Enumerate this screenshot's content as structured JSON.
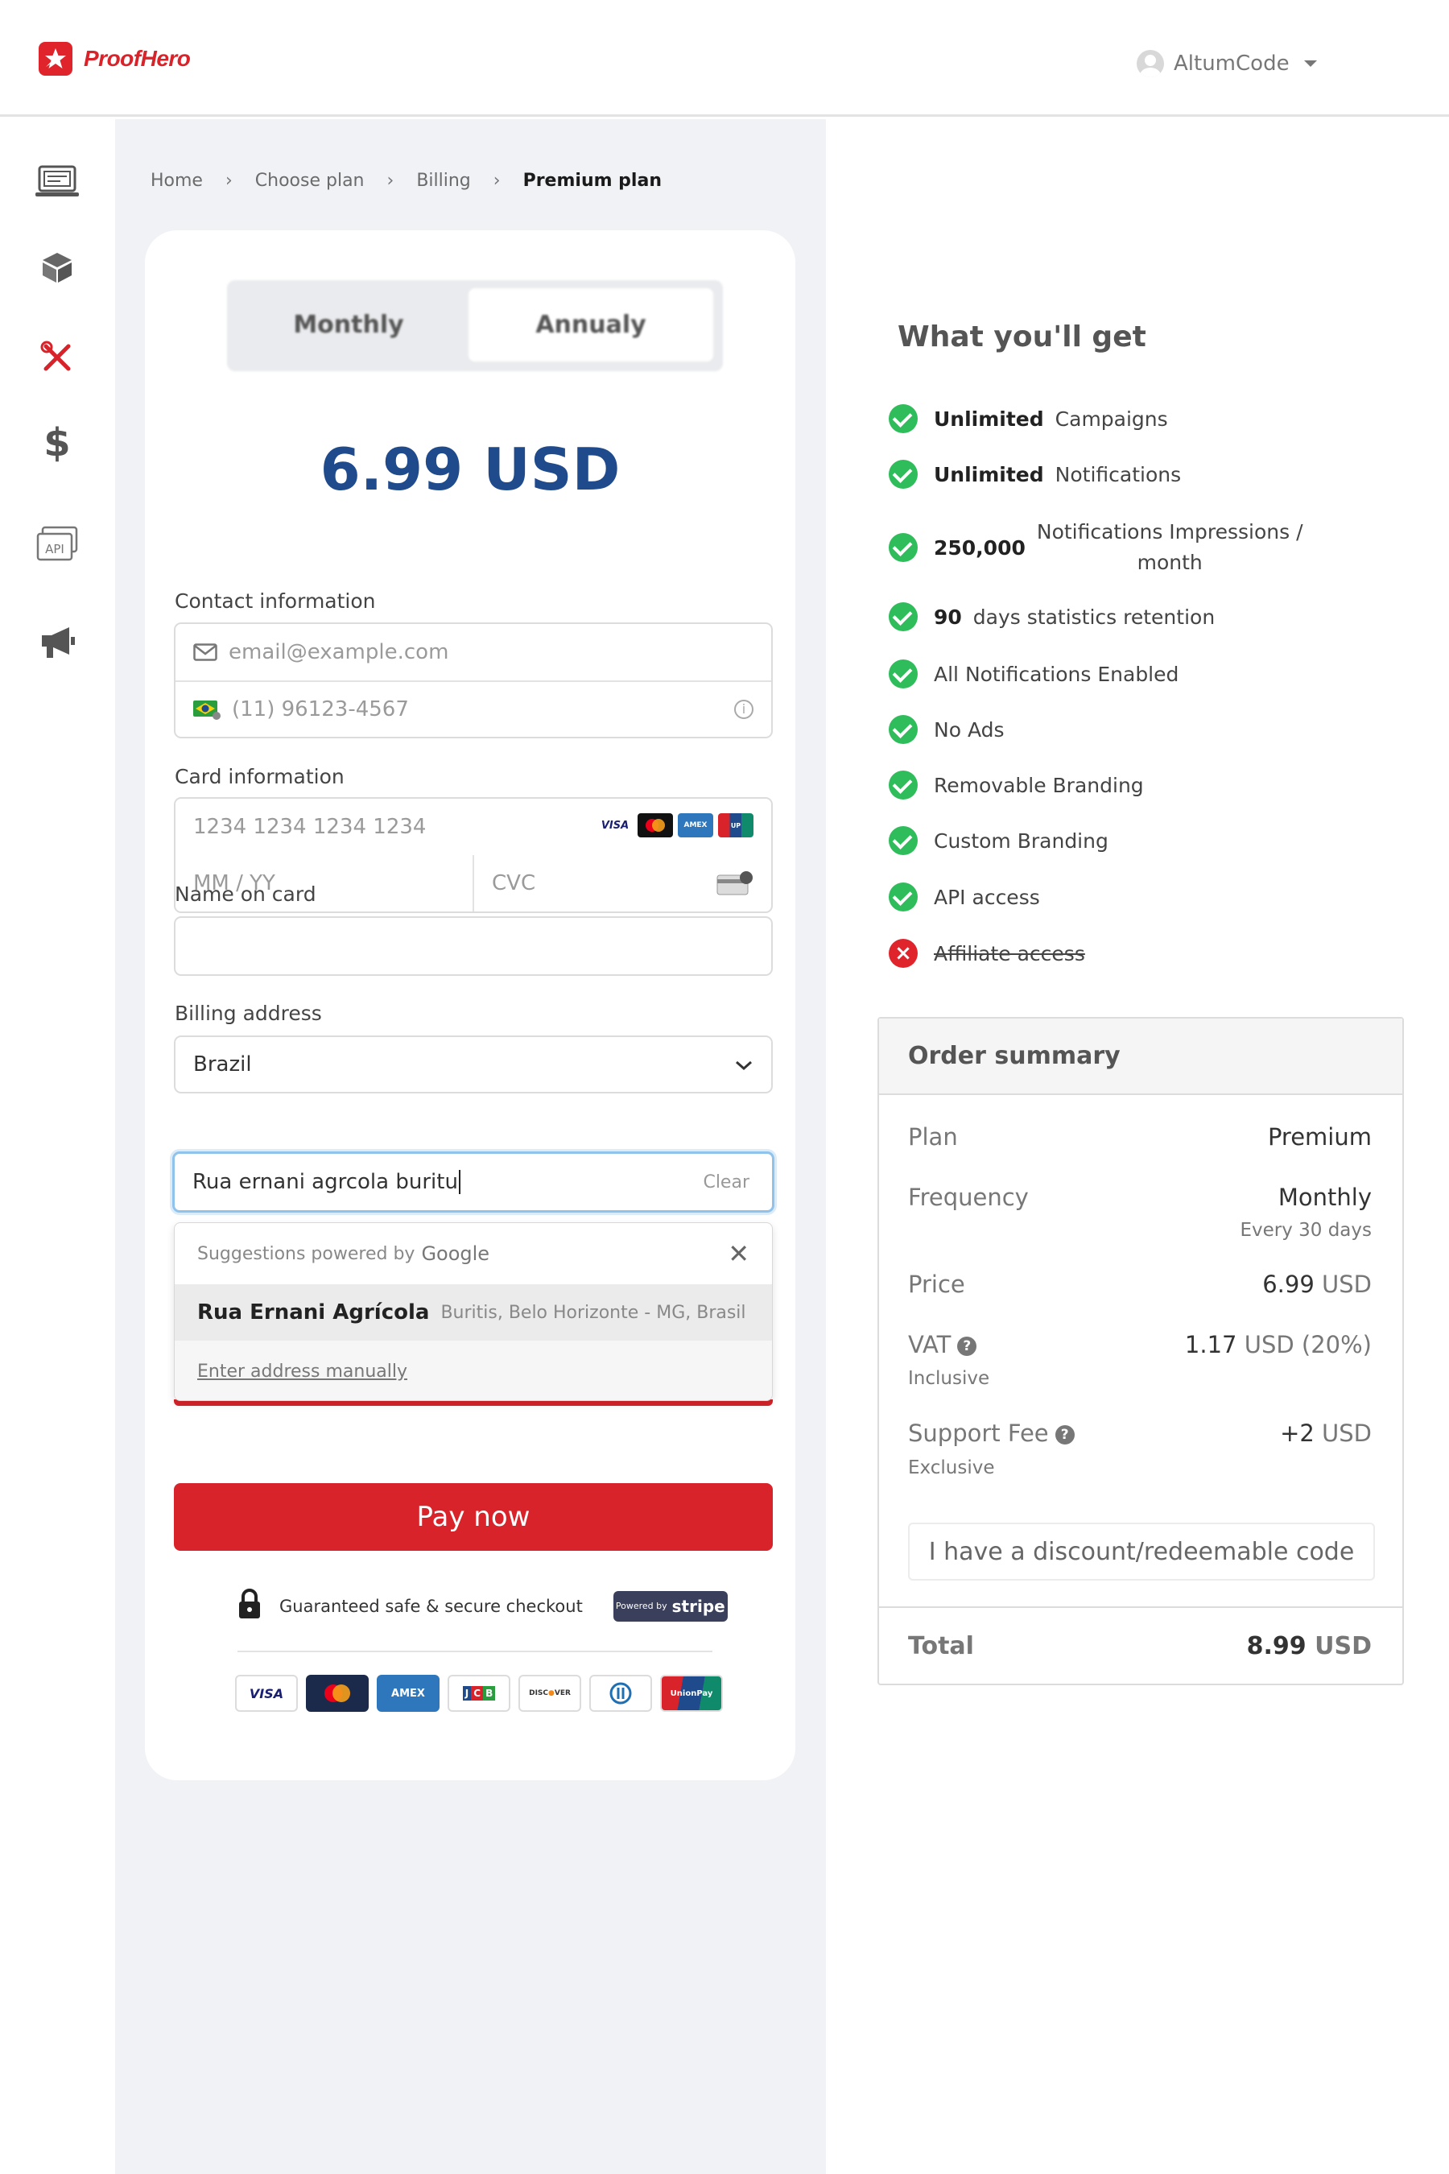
{
  "header": {
    "brand": "ProofHero",
    "user_name": "AltumCode"
  },
  "sidebar": {
    "items": [
      {
        "icon": "dashboard-icon"
      },
      {
        "icon": "package-icon"
      },
      {
        "icon": "tools-icon",
        "active": true
      },
      {
        "icon": "dollar-icon"
      },
      {
        "icon": "api-icon",
        "label": "API"
      },
      {
        "icon": "megaphone-icon"
      }
    ]
  },
  "breadcrumb": [
    "Home",
    "Choose plan",
    "Billing",
    "Premium plan"
  ],
  "checkout": {
    "toggle": {
      "monthly": "Monthly",
      "annual": "Annualy"
    },
    "price": "6.99 USD",
    "contact_label": "Contact information",
    "email_placeholder": "email@example.com",
    "phone_placeholder": "(11) 96123-4567",
    "card_label": "Card information",
    "card_number_placeholder": "1234 1234 1234 1234",
    "expiry_placeholder": "MM / YY",
    "cvc_placeholder": "CVC",
    "card_brands": [
      "VISA",
      "Mastercard",
      "AMEX",
      "UnionPay"
    ],
    "name_label": "Name on card",
    "name_value": "",
    "billing_label": "Billing address",
    "country": "Brazil",
    "address_value": "Rua ernani agrcola buritu",
    "clear_label": "Clear",
    "suggest_header": "Suggestions powered by",
    "suggest_brand": "Google",
    "suggestion_main": "Rua Ernani Agrícola",
    "suggestion_sub": "Buritis, Belo Horizonte - MG, Brasil",
    "manual_label": "Enter address manually",
    "pay_label": "Pay now",
    "secure_text": "Guaranteed safe & secure checkout",
    "stripe_small": "Powered by",
    "stripe_brand": "stripe",
    "payment_methods": [
      "VISA",
      "MC",
      "AMEX",
      "JCB",
      "DISCOVER",
      "Diners",
      "UnionPay"
    ]
  },
  "features": {
    "title": "What you'll get",
    "items": [
      {
        "bold": "Unlimited",
        "text": "Campaigns",
        "ok": true
      },
      {
        "bold": "Unlimited",
        "text": "Notifications",
        "ok": true
      },
      {
        "bold": "250,000",
        "text": "Notifications Impressions /",
        "text2": "month",
        "ok": true
      },
      {
        "bold": "90",
        "text": "days statistics retention",
        "ok": true
      },
      {
        "bold": "",
        "text": "All Notifications Enabled",
        "ok": true
      },
      {
        "bold": "",
        "text": "No Ads",
        "ok": true
      },
      {
        "bold": "",
        "text": "Removable Branding",
        "ok": true
      },
      {
        "bold": "",
        "text": "Custom Branding",
        "ok": true
      },
      {
        "bold": "",
        "text": "API access",
        "ok": true
      },
      {
        "bold": "",
        "text": "Affiliate access",
        "ok": false
      }
    ]
  },
  "summary": {
    "title": "Order summary",
    "plan_label": "Plan",
    "plan_value": "Premium",
    "frequency_label": "Frequency",
    "frequency_value": "Monthly",
    "frequency_sub": "Every 30 days",
    "price_label": "Price",
    "price_amount": "6.99",
    "price_unit": "USD",
    "vat_label": "VAT",
    "vat_amount": "1.17",
    "vat_unit": "USD (20%)",
    "vat_sub": "Inclusive",
    "fee_label": "Support Fee",
    "fee_amount": "+2",
    "fee_unit": "USD",
    "fee_sub": "Exclusive",
    "discount_label": "I have a discount/redeemable code",
    "total_label": "Total",
    "total_amount": "8.99",
    "total_unit": "USD"
  },
  "colors": {
    "brand_red": "#d8232a",
    "price_blue": "#1f4a8c",
    "check_green": "#2ebd5a",
    "panel_gray": "#f1f2f6"
  }
}
